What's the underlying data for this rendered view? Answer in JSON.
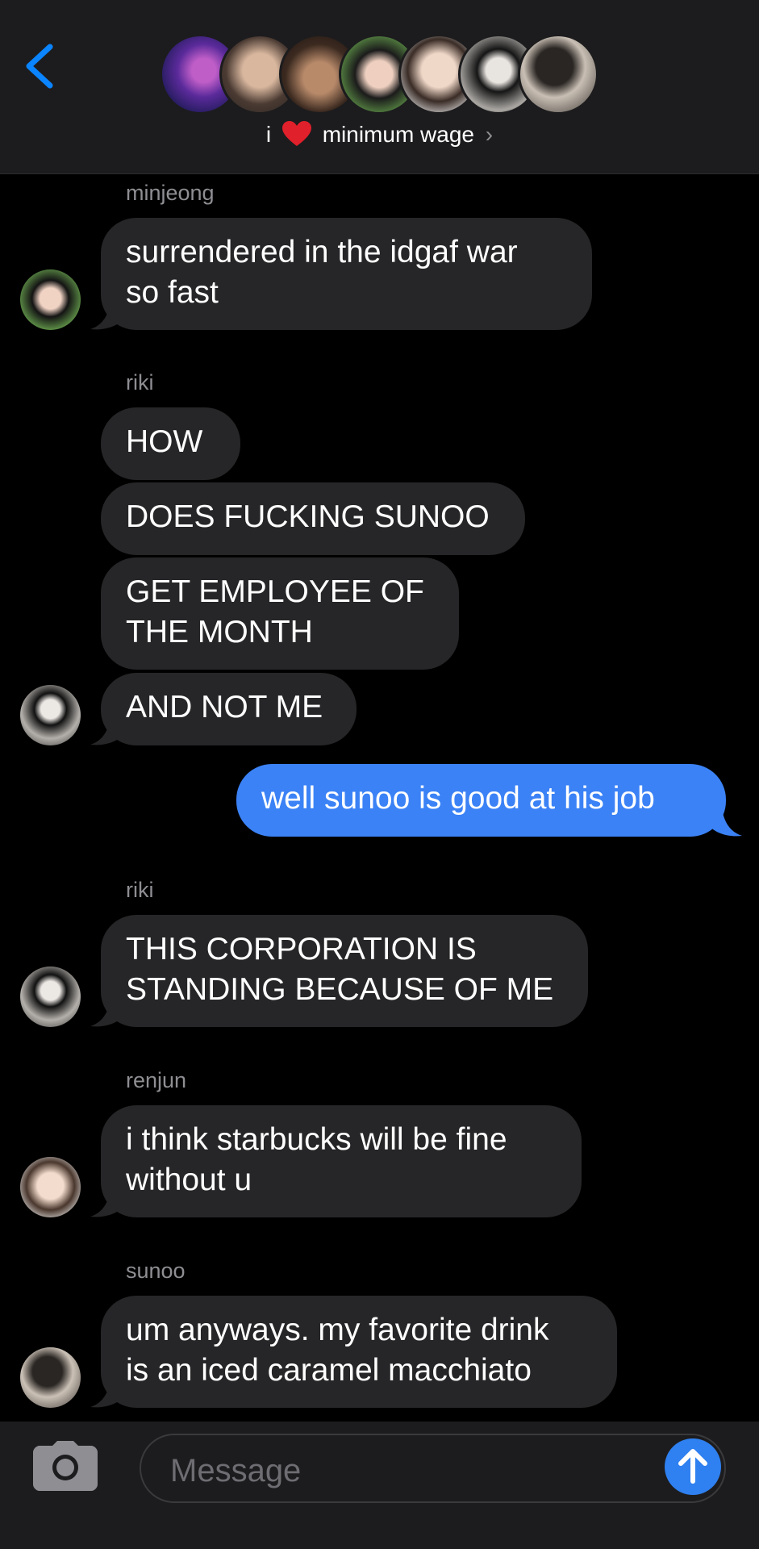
{
  "header": {
    "group_prefix": "i",
    "heart_icon": "red-heart-emoji",
    "group_title": "minimum wage",
    "chevron": "›",
    "accent": "#0a84ff"
  },
  "messages": [
    {
      "sender": "minjeong",
      "lines": [
        "surrendered in the idgaf war",
        "so fast"
      ]
    },
    {
      "sender": "riki",
      "bubbles": [
        "HOW",
        "DOES FUCKING SUNOO",
        "GET EMPLOYEE OF\nTHE MONTH",
        "AND NOT ME"
      ]
    },
    {
      "outgoing": "well sunoo is good at his job"
    },
    {
      "sender": "riki",
      "lines": [
        "THIS CORPORATION IS",
        "STANDING BECAUSE OF ME"
      ]
    },
    {
      "sender": "renjun",
      "lines": [
        "i think starbucks will be fine",
        "without u"
      ]
    },
    {
      "sender": "sunoo",
      "lines": [
        "um anyways. my favorite drink",
        "is an iced caramel macchiato"
      ]
    }
  ],
  "m1": {
    "sender": "minjeong",
    "l1": "surrendered in the idgaf war",
    "l2": "so fast"
  },
  "m2": {
    "sender": "riki",
    "b1": "HOW",
    "b2": "DOES FUCKING SUNOO",
    "b3l1": "GET EMPLOYEE OF",
    "b3l2": "THE MONTH",
    "b4": "AND NOT ME"
  },
  "m3": {
    "text": "well sunoo is good at his job"
  },
  "m4": {
    "sender": "riki",
    "l1": "THIS CORPORATION IS",
    "l2": "STANDING BECAUSE OF ME"
  },
  "m5": {
    "sender": "renjun",
    "l1": "i think starbucks will be fine",
    "l2": "without u"
  },
  "m6": {
    "sender": "sunoo",
    "l1": "um anyways. my favorite drink",
    "l2": "is an iced caramel macchiato"
  },
  "composer": {
    "placeholder": "Message",
    "camera_icon": "camera-icon",
    "send_icon": "arrow-up-icon"
  },
  "colors": {
    "incoming_bubble": "#262628",
    "outgoing_bubble": "#3b82f6",
    "background": "#000000",
    "header_bg": "#1c1c1e"
  }
}
